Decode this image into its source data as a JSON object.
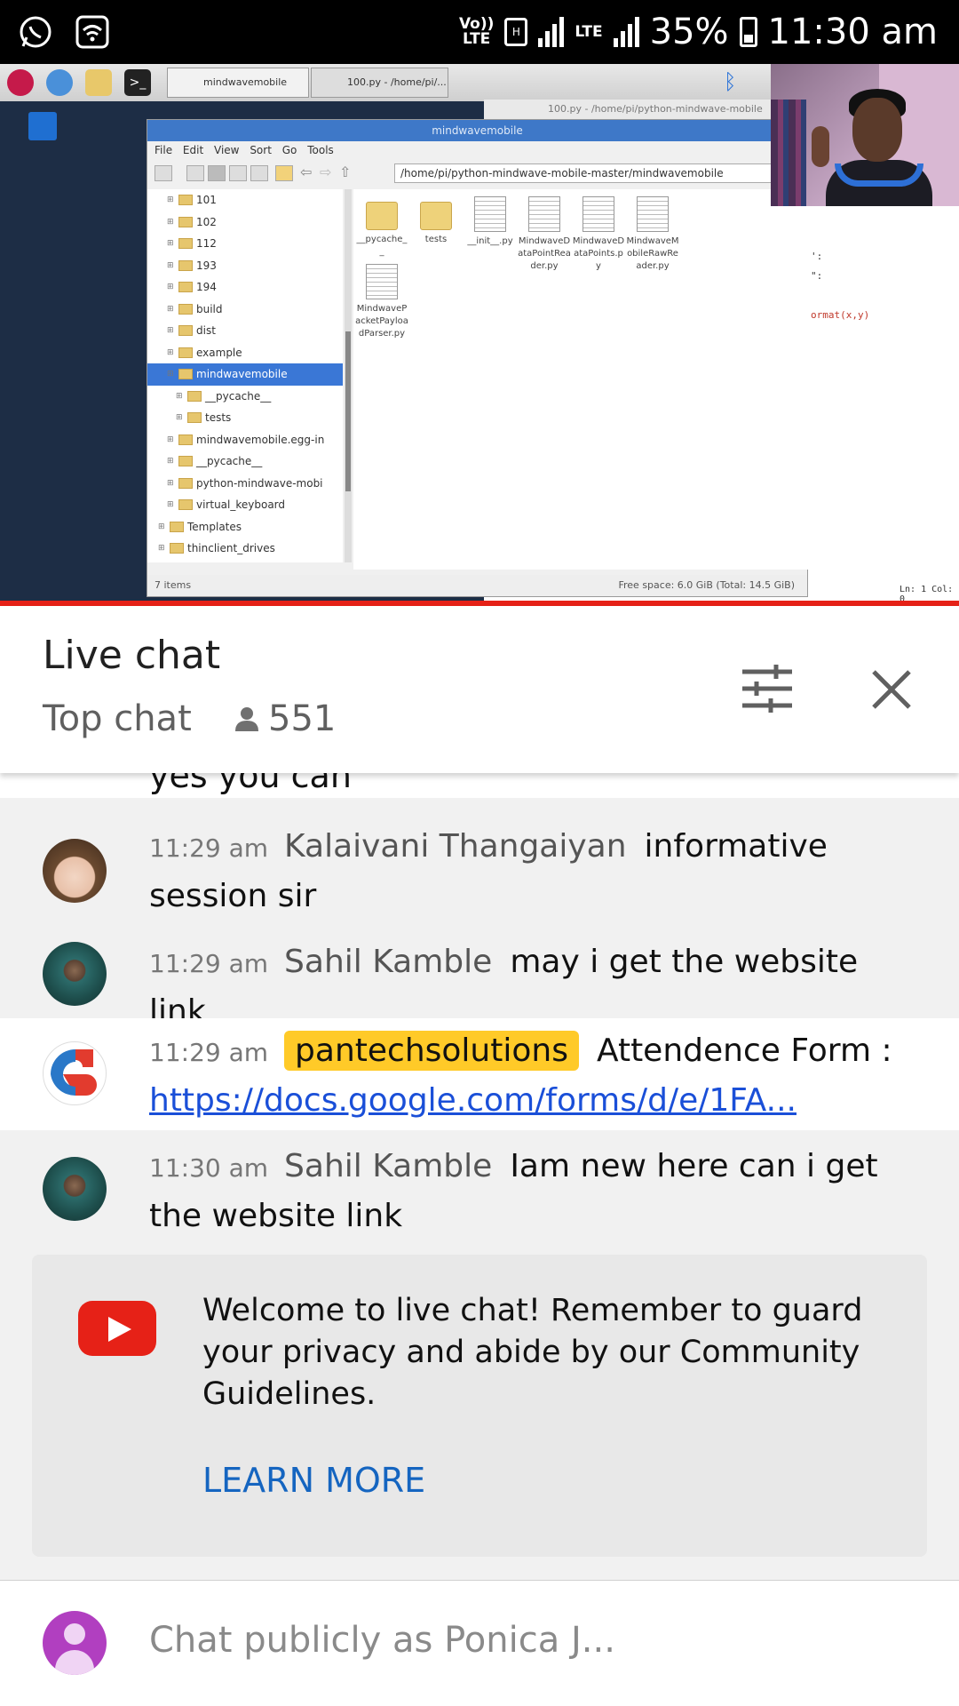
{
  "status_bar": {
    "left_icons": [
      "whatsapp-icon",
      "wifi-icon"
    ],
    "volte": "Vo))\nLTE",
    "lte": "LTE",
    "battery": "35%",
    "time": "11:30 am"
  },
  "video": {
    "desktop_tab": "mindwavemobile",
    "editor_tab": "100.py - /home/pi/...",
    "editor_title": "100.py - /home/pi/python-mindwave-mobile",
    "file_manager": {
      "title": "mindwavemobile",
      "menu": [
        "File",
        "Edit",
        "View",
        "Sort",
        "Go",
        "Tools"
      ],
      "path": "/home/pi/python-mindwave-mobile-master/mindwavemobile",
      "tree": [
        {
          "label": "101",
          "level": 1
        },
        {
          "label": "102",
          "level": 1
        },
        {
          "label": "112",
          "level": 1
        },
        {
          "label": "193",
          "level": 1
        },
        {
          "label": "194",
          "level": 1
        },
        {
          "label": "build",
          "level": 1
        },
        {
          "label": "dist",
          "level": 1
        },
        {
          "label": "example",
          "level": 1
        },
        {
          "label": "mindwavemobile",
          "level": 1,
          "selected": true
        },
        {
          "label": "__pycache__",
          "level": 2
        },
        {
          "label": "tests",
          "level": 2
        },
        {
          "label": "mindwavemobile.egg-in",
          "level": 1
        },
        {
          "label": "__pycache__",
          "level": 1
        },
        {
          "label": "python-mindwave-mobi",
          "level": 1
        },
        {
          "label": "virtual_keyboard",
          "level": 1
        },
        {
          "label": "Templates",
          "level": 0
        },
        {
          "label": "thinclient_drives",
          "level": 0
        }
      ],
      "files": [
        {
          "name": "__pycache__",
          "kind": "folder"
        },
        {
          "name": "tests",
          "kind": "folder"
        },
        {
          "name": "__init__.py",
          "kind": "doc"
        },
        {
          "name": "MindwaveDataPointReader.py",
          "kind": "doc"
        },
        {
          "name": "MindwaveDataPoints.py",
          "kind": "doc"
        },
        {
          "name": "MindwaveMobileRawReader.py",
          "kind": "doc"
        },
        {
          "name": "MindwavePacketPayloadParser.py",
          "kind": "doc"
        }
      ],
      "status_left": "7 items",
      "status_right": "Free space: 6.0 GiB (Total: 14.5 GiB)"
    },
    "editor_code": [
      "':",
      "\":",
      "ormat(x,y)"
    ],
    "editor_status": "Ln: 1  Col: 0"
  },
  "chat_header": {
    "title": "Live chat",
    "mode": "Top chat",
    "viewers": "551"
  },
  "partial_message": "yes you can",
  "messages": [
    {
      "time": "11:29 am",
      "author": "Kalaivani Thangaiyan",
      "text": "informative session sir",
      "avatar": "doll-avatar"
    },
    {
      "time": "11:29 am",
      "author": "Sahil Kamble",
      "text": "may i get the website link",
      "avatar": "user-photo-avatar"
    },
    {
      "time": "11:29 am",
      "author": "pantechsolutions",
      "text": "Attendence Form :",
      "link": "https://docs.google.com/forms/d/e/1FA...",
      "avatar": "pantech-logo-avatar",
      "owner": true
    },
    {
      "time": "11:30 am",
      "author": "Sahil Kamble",
      "text": "Iam new here can i get the website link",
      "avatar": "user-photo-avatar"
    }
  ],
  "welcome": {
    "text": "Welcome to live chat! Remember to guard your privacy and abide by our Community Guidelines.",
    "learn_more": "LEARN MORE"
  },
  "input": {
    "placeholder": "Chat publicly as Ponica J..."
  },
  "colors": {
    "owner_badge": "#ffca28",
    "link": "#1a4fd8",
    "youtube_red": "#e62117",
    "learn_more": "#1565c0"
  }
}
